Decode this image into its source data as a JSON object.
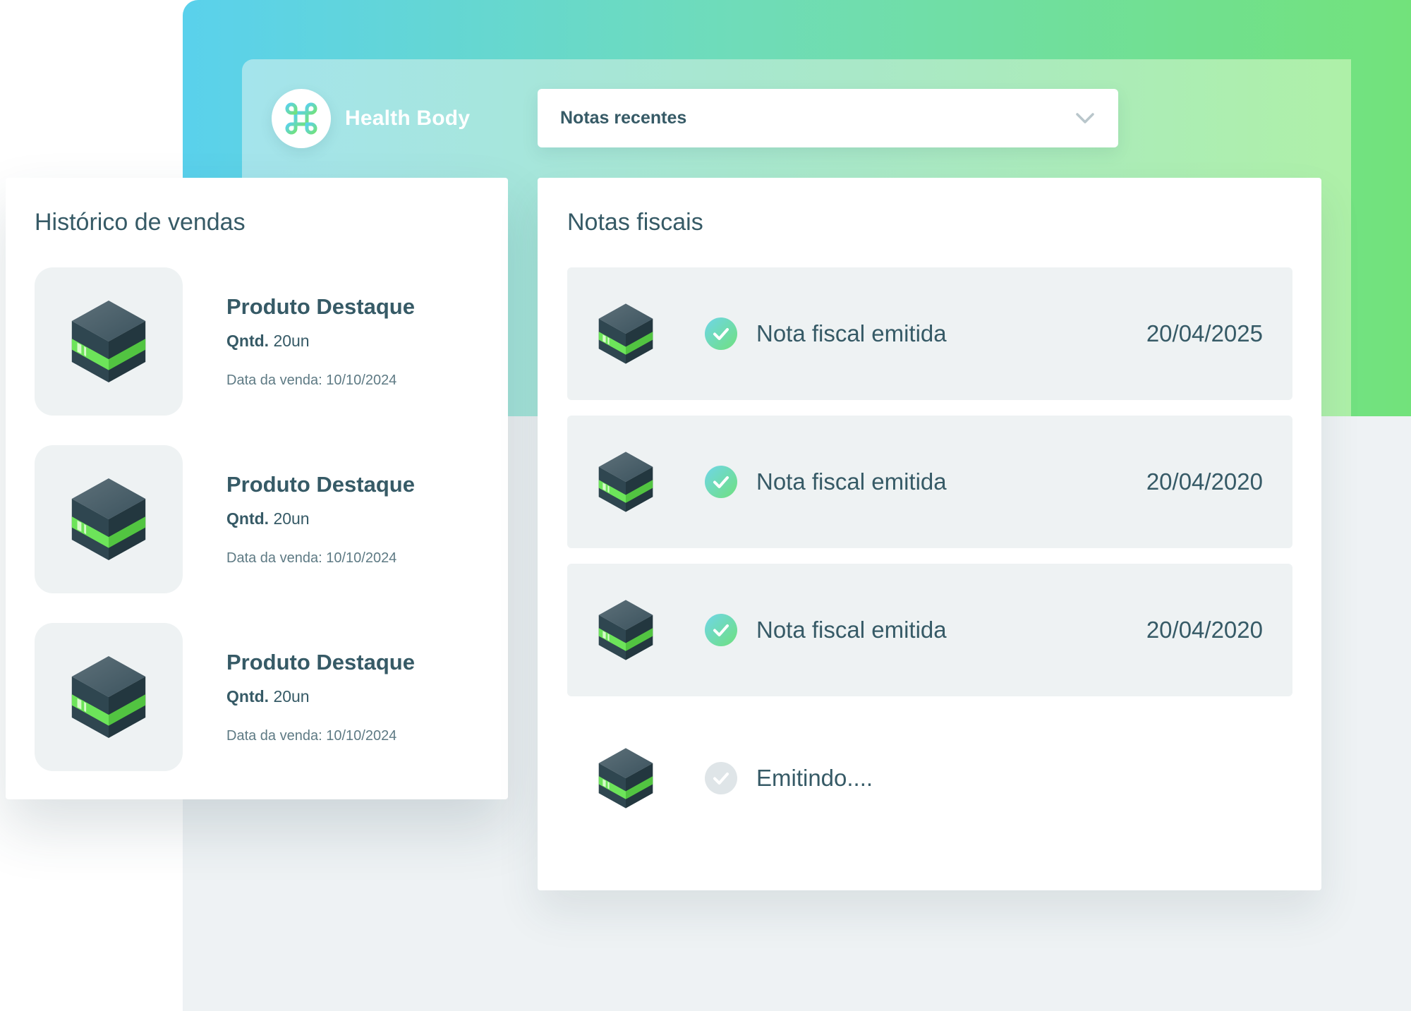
{
  "app": {
    "name": "Health Body",
    "logo_icon": "command-icon"
  },
  "header": {
    "dropdown": {
      "selected": "Notas recentes",
      "icon": "chevron-down-icon"
    }
  },
  "history": {
    "title": "Histórico de vendas",
    "items": [
      {
        "name": "Produto Destaque",
        "qty_label": "Qntd.",
        "qty_value": "20un",
        "date": "Data da venda: 10/10/2024",
        "icon": "product-cube-icon"
      },
      {
        "name": "Produto Destaque",
        "qty_label": "Qntd.",
        "qty_value": "20un",
        "date": "Data da venda: 10/10/2024",
        "icon": "product-cube-icon"
      },
      {
        "name": "Produto Destaque",
        "qty_label": "Qntd.",
        "qty_value": "20un",
        "date": "Data da venda: 10/10/2024",
        "icon": "product-cube-icon"
      }
    ]
  },
  "invoices": {
    "title": "Notas fiscais",
    "items": [
      {
        "status": "Nota fiscal emitida",
        "date": "20/04/2025",
        "state": "done",
        "icon": "check-circle-icon"
      },
      {
        "status": "Nota fiscal emitida",
        "date": "20/04/2020",
        "state": "done",
        "icon": "check-circle-icon"
      },
      {
        "status": "Nota fiscal emitida",
        "date": "20/04/2020",
        "state": "done",
        "icon": "check-circle-icon"
      },
      {
        "status": "Emitindo....",
        "date": "",
        "state": "pending",
        "icon": "check-circle-icon"
      }
    ]
  },
  "colors": {
    "accent_blue": "#5ad1ec",
    "accent_green": "#72e27b",
    "text_dark": "#365a66",
    "check_done": "#5fd6a7",
    "check_pending": "#dfe5e8"
  }
}
